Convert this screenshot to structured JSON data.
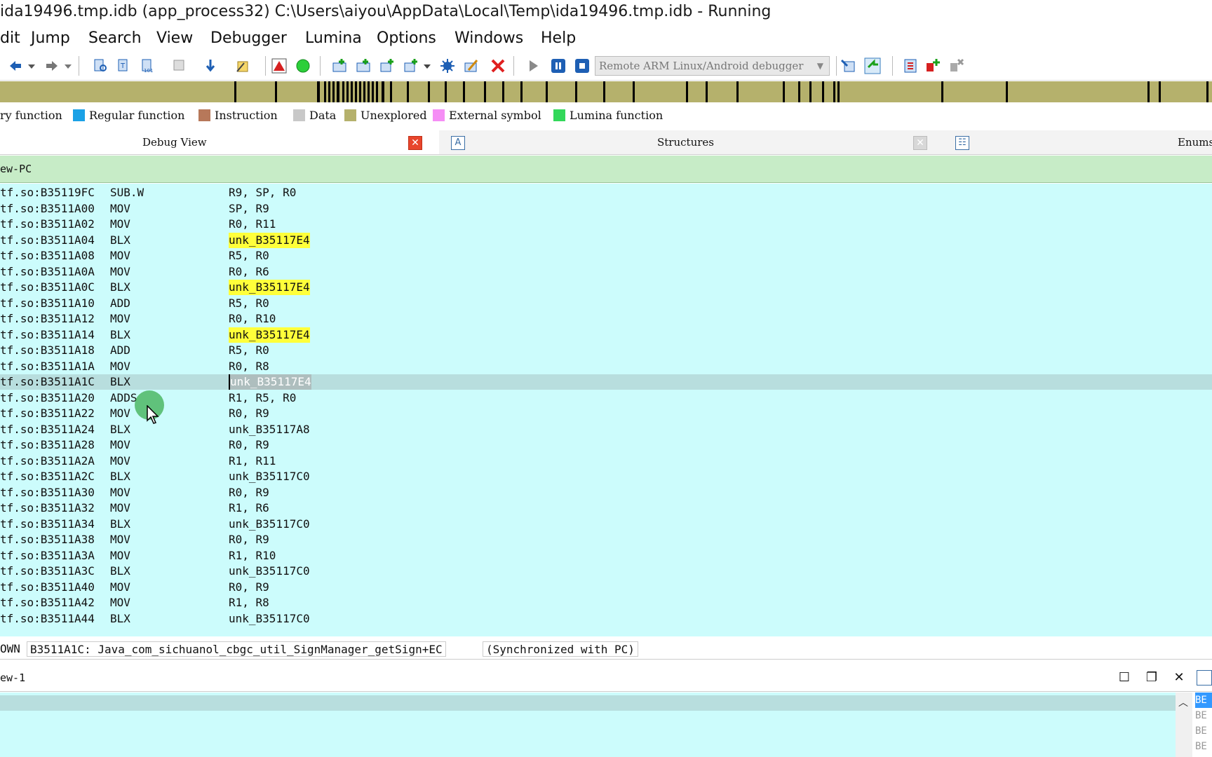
{
  "window": {
    "title": "ida19496.tmp.idb (app_process32) C:\\Users\\aiyou\\AppData\\Local\\Temp\\ida19496.tmp.idb - Running"
  },
  "menu": [
    "dit",
    "Jump",
    "Search",
    "View",
    "Debugger",
    "Lumina",
    "Options",
    "Windows",
    "Help"
  ],
  "toolbar": {
    "debugger_select": "Remote ARM Linux/Android debugger"
  },
  "legend": [
    {
      "label": "ry function",
      "color": ""
    },
    {
      "label": "Regular function",
      "color": "#1aa1e6"
    },
    {
      "label": "Instruction",
      "color": "#b7785a"
    },
    {
      "label": "Data",
      "color": "#c8c8c8"
    },
    {
      "label": "Unexplored",
      "color": "#b5b16c"
    },
    {
      "label": "External symbol",
      "color": "#f58ef5"
    },
    {
      "label": "Lumina function",
      "color": "#32d85a"
    }
  ],
  "tabs": {
    "debug_view": "Debug View",
    "structures": "Structures",
    "enums": "Enums",
    "structures_icon": "A"
  },
  "view_header": "ew-PC",
  "listing": [
    {
      "addr": "tf.so:B35119FC",
      "mnem": "SUB.W",
      "ops": "R9, SP, R0",
      "hl": ""
    },
    {
      "addr": "tf.so:B3511A00",
      "mnem": "MOV",
      "ops": "SP, R9",
      "hl": ""
    },
    {
      "addr": "tf.so:B3511A02",
      "mnem": "MOV",
      "ops": "R0, R11",
      "hl": ""
    },
    {
      "addr": "tf.so:B3511A04",
      "mnem": "BLX",
      "ops": "unk_B35117E4",
      "hl": "yellow"
    },
    {
      "addr": "tf.so:B3511A08",
      "mnem": "MOV",
      "ops": "R5, R0",
      "hl": ""
    },
    {
      "addr": "tf.so:B3511A0A",
      "mnem": "MOV",
      "ops": "R0, R6",
      "hl": ""
    },
    {
      "addr": "tf.so:B3511A0C",
      "mnem": "BLX",
      "ops": "unk_B35117E4",
      "hl": "yellow"
    },
    {
      "addr": "tf.so:B3511A10",
      "mnem": "ADD",
      "ops": "R5, R0",
      "hl": ""
    },
    {
      "addr": "tf.so:B3511A12",
      "mnem": "MOV",
      "ops": "R0, R10",
      "hl": ""
    },
    {
      "addr": "tf.so:B3511A14",
      "mnem": "BLX",
      "ops": "unk_B35117E4",
      "hl": "yellow"
    },
    {
      "addr": "tf.so:B3511A18",
      "mnem": "ADD",
      "ops": "R5, R0",
      "hl": ""
    },
    {
      "addr": "tf.so:B3511A1A",
      "mnem": "MOV",
      "ops": "R0, R8",
      "hl": ""
    },
    {
      "addr": "tf.so:B3511A1C",
      "mnem": "BLX",
      "ops": "unk_B35117E4",
      "hl": "current"
    },
    {
      "addr": "tf.so:B3511A20",
      "mnem": "ADDS",
      "ops": "R1, R5, R0",
      "hl": ""
    },
    {
      "addr": "tf.so:B3511A22",
      "mnem": "MOV",
      "ops": "R0, R9",
      "hl": ""
    },
    {
      "addr": "tf.so:B3511A24",
      "mnem": "BLX",
      "ops": "unk_B35117A8",
      "hl": ""
    },
    {
      "addr": "tf.so:B3511A28",
      "mnem": "MOV",
      "ops": "R0, R9",
      "hl": ""
    },
    {
      "addr": "tf.so:B3511A2A",
      "mnem": "MOV",
      "ops": "R1, R11",
      "hl": ""
    },
    {
      "addr": "tf.so:B3511A2C",
      "mnem": "BLX",
      "ops": "unk_B35117C0",
      "hl": ""
    },
    {
      "addr": "tf.so:B3511A30",
      "mnem": "MOV",
      "ops": "R0, R9",
      "hl": ""
    },
    {
      "addr": "tf.so:B3511A32",
      "mnem": "MOV",
      "ops": "R1, R6",
      "hl": ""
    },
    {
      "addr": "tf.so:B3511A34",
      "mnem": "BLX",
      "ops": "unk_B35117C0",
      "hl": ""
    },
    {
      "addr": "tf.so:B3511A38",
      "mnem": "MOV",
      "ops": "R0, R9",
      "hl": ""
    },
    {
      "addr": "tf.so:B3511A3A",
      "mnem": "MOV",
      "ops": "R1, R10",
      "hl": ""
    },
    {
      "addr": "tf.so:B3511A3C",
      "mnem": "BLX",
      "ops": "unk_B35117C0",
      "hl": ""
    },
    {
      "addr": "tf.so:B3511A40",
      "mnem": "MOV",
      "ops": "R0, R9",
      "hl": ""
    },
    {
      "addr": "tf.so:B3511A42",
      "mnem": "MOV",
      "ops": "R1, R8",
      "hl": ""
    },
    {
      "addr": "tf.so:B3511A44",
      "mnem": "BLX",
      "ops": "unk_B35117C0",
      "hl": ""
    }
  ],
  "status": {
    "prefix": "OWN",
    "location": "B3511A1C: Java_com_sichuanol_cbgc_util_SignManager_getSign+EC",
    "sync": "(Synchronized with PC)"
  },
  "bottom": {
    "header": "ew-1",
    "right_items": [
      "BE",
      "BE",
      "BE",
      "BE"
    ]
  },
  "colors": {
    "listing_bg": "#ccfcfc",
    "highlight": "#ffff3a",
    "view_header_bg": "#c7ecc7",
    "nav_band": "#b5b16c"
  }
}
